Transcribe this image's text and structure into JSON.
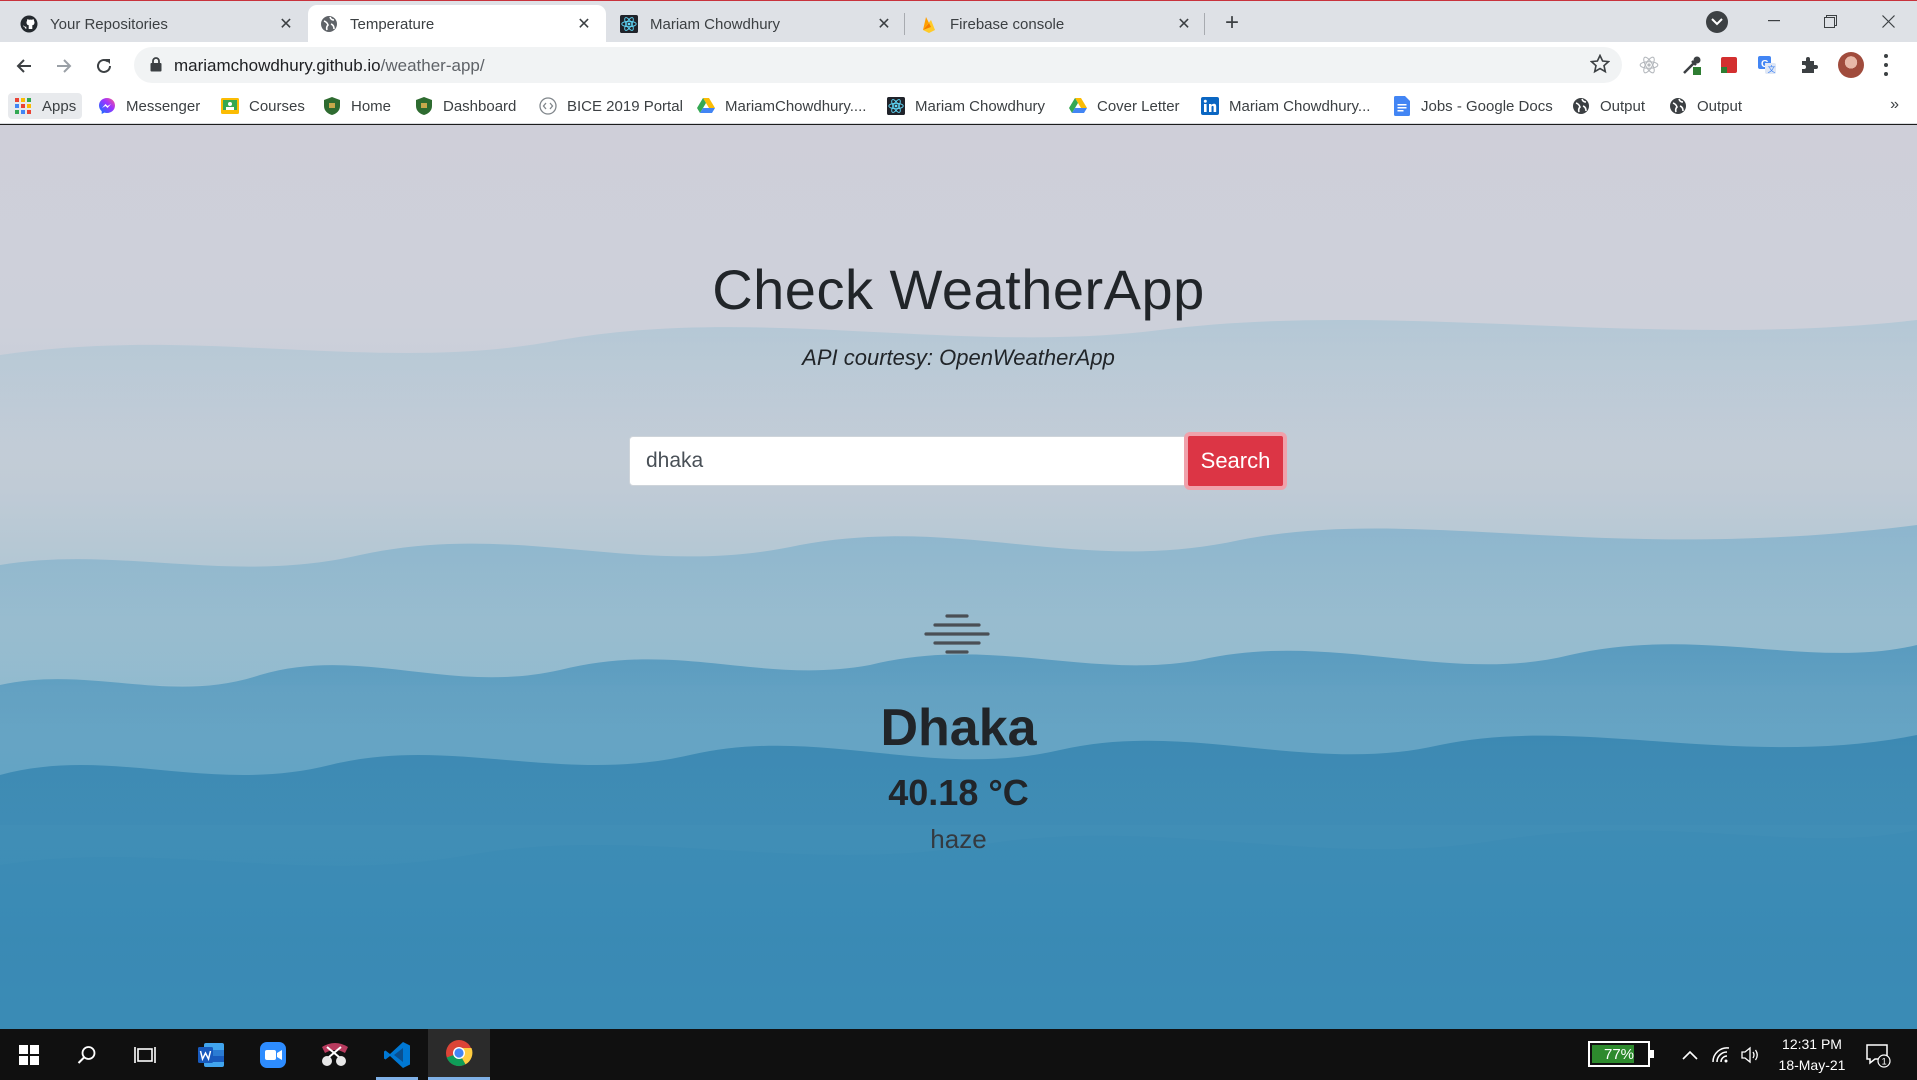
{
  "browser": {
    "tabs": [
      {
        "title": "Your Repositories",
        "favicon": "github-icon",
        "active": false
      },
      {
        "title": "Temperature",
        "favicon": "globe-icon",
        "active": true
      },
      {
        "title": "Mariam Chowdhury",
        "favicon": "react-icon",
        "active": false
      },
      {
        "title": "Firebase console",
        "favicon": "firebase-icon",
        "active": false
      }
    ],
    "url_host": "mariamchowdhury.github.io",
    "url_path": "/weather-app/"
  },
  "bookmarks": [
    {
      "label": "Apps",
      "icon": "apps-grid-icon"
    },
    {
      "label": "Messenger",
      "icon": "messenger-icon"
    },
    {
      "label": "Courses",
      "icon": "classroom-icon"
    },
    {
      "label": "Home",
      "icon": "shield-icon"
    },
    {
      "label": "Dashboard",
      "icon": "shield-icon"
    },
    {
      "label": "BICE 2019 Portal",
      "icon": "code-icon"
    },
    {
      "label": "MariamChowdhury....",
      "icon": "drive-icon"
    },
    {
      "label": "Mariam Chowdhury",
      "icon": "react-icon"
    },
    {
      "label": "Cover Letter",
      "icon": "drive-icon"
    },
    {
      "label": "Mariam Chowdhury...",
      "icon": "linkedin-icon"
    },
    {
      "label": "Jobs - Google Docs",
      "icon": "docs-icon"
    },
    {
      "label": "Output",
      "icon": "globe-icon"
    },
    {
      "label": "Output",
      "icon": "globe-icon"
    }
  ],
  "page": {
    "title": "Check WeatherApp",
    "courtesy_prefix": "API courtesy: ",
    "courtesy_name": "OpenWeatherApp",
    "search": {
      "value": "dhaka",
      "button_label": "Search"
    },
    "weather": {
      "icon": "haze-icon",
      "city": "Dhaka",
      "temperature": "40.18 °C",
      "condition": "haze"
    }
  },
  "taskbar": {
    "apps": [
      "windows-start-icon",
      "search-icon",
      "task-view-icon",
      "word-icon",
      "zoom-icon",
      "snip-sketch-icon",
      "vscode-icon",
      "chrome-icon"
    ],
    "battery_percent": 77,
    "battery_label": "77%",
    "time": "12:31 PM",
    "date": "18-May-21",
    "notification_count": "1"
  },
  "colors": {
    "accent_button": "#dc3545",
    "text_dark": "#212529",
    "tab_strip": "#dee1e6",
    "taskbar": "#101010"
  }
}
